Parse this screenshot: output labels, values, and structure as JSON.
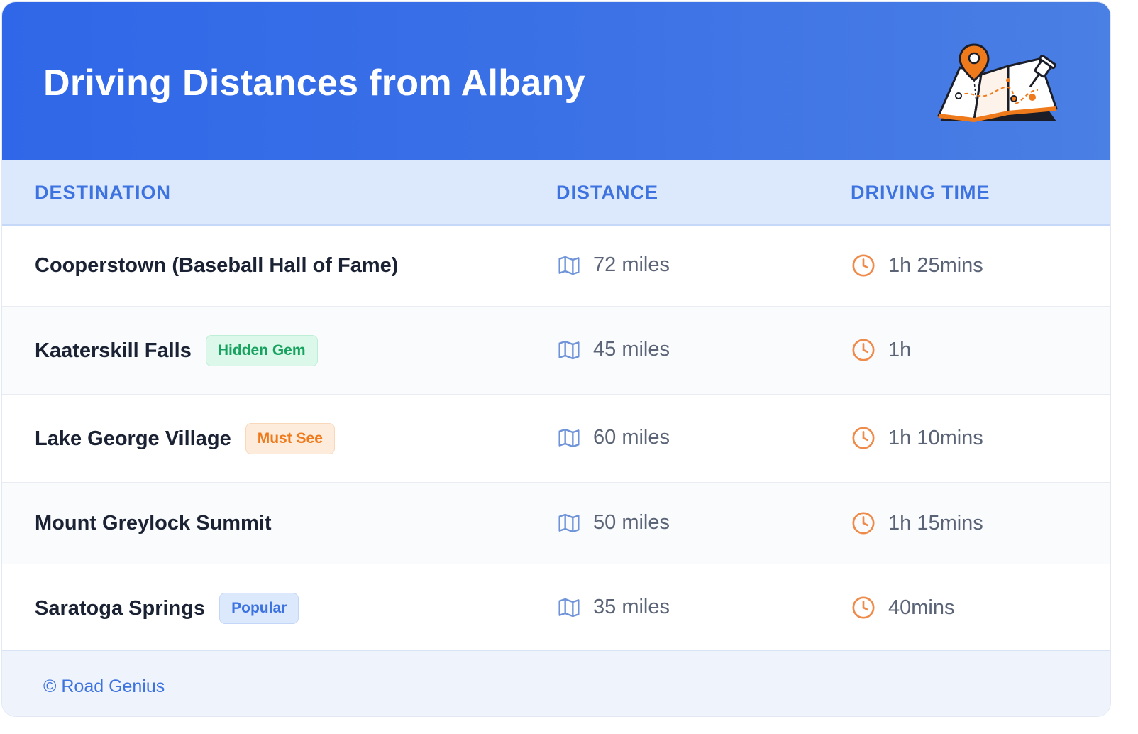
{
  "header": {
    "title": "Driving Distances from Albany",
    "illustration_icon": "folded-map-with-pin-icon"
  },
  "table": {
    "columns": [
      "DESTINATION",
      "DISTANCE",
      "DRIVING TIME"
    ],
    "distance_icon": "map-icon",
    "time_icon": "clock-icon",
    "rows": [
      {
        "destination": "Cooperstown (Baseball Hall of Fame)",
        "badge": "",
        "distance": "72 miles",
        "time": "1h 25mins"
      },
      {
        "destination": "Kaaterskill Falls",
        "badge": "Hidden Gem",
        "badge_color": "#17a35f",
        "distance": "45 miles",
        "time": "1h"
      },
      {
        "destination": "Lake George Village",
        "badge": "Must See",
        "badge_color": "#ef7a1c",
        "distance": "60 miles",
        "time": "1h 10mins"
      },
      {
        "destination": "Mount Greylock Summit",
        "badge": "",
        "distance": "50 miles",
        "time": "1h 15mins"
      },
      {
        "destination": "Saratoga Springs",
        "badge": "Popular",
        "badge_color": "#3d73e0",
        "distance": "35 miles",
        "time": "40mins"
      }
    ]
  },
  "footer": {
    "text": "© Road Genius"
  },
  "colors": {
    "header_blue": "#2f67e8",
    "accent_blue": "#3d73e0",
    "accent_orange": "#ef7a1c",
    "map_icon": "#6f93d8",
    "clock_icon": "#ef8b4a"
  }
}
